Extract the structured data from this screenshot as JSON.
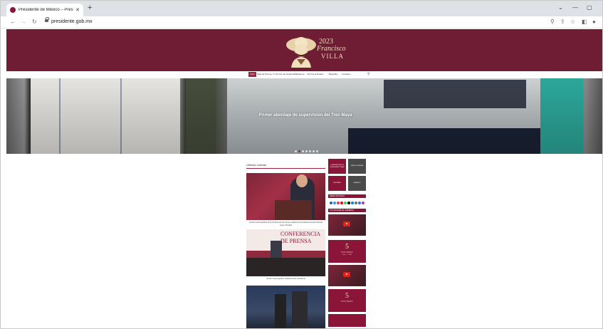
{
  "browser": {
    "tab_title": "Presidente de México – Preside",
    "tab_close": "✕",
    "new_tab": "+",
    "url": "presidente.gob.mx",
    "window_controls": {
      "collapse": "⌄",
      "minimize": "—",
      "maximize": "▢"
    },
    "nav": {
      "back": "←",
      "forward": "→",
      "reload": "↻"
    },
    "tools": {
      "search": "⚲",
      "share": "⇪",
      "bookmark": "☆",
      "sidepanel": "◧",
      "profile": "●"
    }
  },
  "header": {
    "logo_year": "2023",
    "logo_name": "Francisco",
    "logo_villa": "VILLA"
  },
  "nav_items": [
    "Inicio",
    "Sala de Prensa",
    "4° Informe de Gobierno",
    "Mañanera",
    "Informe al Pueblo",
    "Biografía",
    "Contacto"
  ],
  "nav_search": "⚲",
  "hero": {
    "caption": "Primer abordaje de supervisión del Tren Maya",
    "slide_count": 7,
    "active_slide": 1
  },
  "news": {
    "heading": "Últimas noticias",
    "items": [
      {
        "caption": "Versión estenográfica de la conferencia de prensa matutina del presidente Andrés Manuel López Obrador"
      },
      {
        "caption": "Versión estenográfica. Mañanera del presidente"
      },
      {
        "caption": ""
      }
    ],
    "banner_text_1": "CONFERENCIA",
    "banner_text_2": "DE PRENSA"
  },
  "sidebar": {
    "tiles": [
      "CONFERENCIAS DE PRENSA MATUTINAS",
      "SALA DE PRENSA",
      "INFORMES",
      "GABINETE"
    ],
    "social_bar": "REDES SOCIALES",
    "report_bar": "5TO INFORME DE GOBIERNO",
    "informe_number": "5",
    "informe_label": "INFORME",
    "informe_years": "2022 — 2023",
    "social_colors": [
      "#3b5998",
      "#1da1f2",
      "#e1306c",
      "#ff0000",
      "#25d366",
      "#000000",
      "#0088cc",
      "#6a6a6a",
      "#1877f2",
      "#c13584"
    ]
  }
}
